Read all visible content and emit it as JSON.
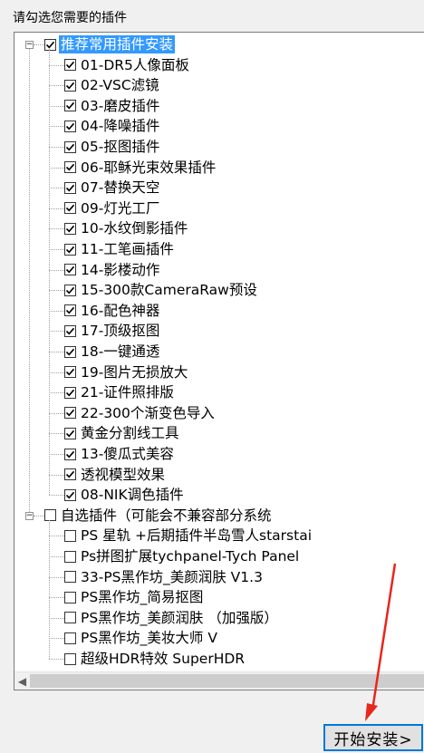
{
  "prompt": "请勾选您需要的插件",
  "groups": [
    {
      "label": "推荐常用插件安装",
      "expanded": true,
      "checked": true,
      "selected": true,
      "items": [
        {
          "label": "01-DR5人像面板",
          "checked": true
        },
        {
          "label": "02-VSC滤镜",
          "checked": true
        },
        {
          "label": "03-磨皮插件",
          "checked": true
        },
        {
          "label": "04-降噪插件",
          "checked": true
        },
        {
          "label": "05-抠图插件",
          "checked": true
        },
        {
          "label": "06-耶稣光束效果插件",
          "checked": true
        },
        {
          "label": "07-替换天空",
          "checked": true
        },
        {
          "label": "09-灯光工厂",
          "checked": true
        },
        {
          "label": "10-水纹倒影插件",
          "checked": true
        },
        {
          "label": "11-工笔画插件",
          "checked": true
        },
        {
          "label": "14-影楼动作",
          "checked": true
        },
        {
          "label": "15-300款CameraRaw预设",
          "checked": true
        },
        {
          "label": "16-配色神器",
          "checked": true
        },
        {
          "label": "17-顶级抠图",
          "checked": true
        },
        {
          "label": "18-一键通透",
          "checked": true
        },
        {
          "label": "19-图片无损放大",
          "checked": true
        },
        {
          "label": "21-证件照排版",
          "checked": true
        },
        {
          "label": "22-300个渐变色导入",
          "checked": true
        },
        {
          "label": "黄金分割线工具",
          "checked": true
        },
        {
          "label": "13-傻瓜式美容",
          "checked": true
        },
        {
          "label": "透视模型效果",
          "checked": true
        },
        {
          "label": "08-NIK调色插件",
          "checked": true
        }
      ]
    },
    {
      "label": "自选插件（可能会不兼容部分系统",
      "expanded": true,
      "checked": false,
      "selected": false,
      "items": [
        {
          "label": "PS 星轨 +后期插件半岛雪人starstai",
          "checked": false
        },
        {
          "label": "Ps拼图扩展tychpanel-Tych Panel",
          "checked": false
        },
        {
          "label": "33-PS黑作坊_美颜润肤 V1.3",
          "checked": false
        },
        {
          "label": "PS黑作坊_简易抠图",
          "checked": false
        },
        {
          "label": "PS黑作坊_美颜润肤 （加强版）",
          "checked": false
        },
        {
          "label": "PS黑作坊_美妆大师 V",
          "checked": false
        },
        {
          "label": "超级HDR特效 SuperHDR",
          "checked": false
        }
      ]
    }
  ],
  "install_button": "开始安装>",
  "colors": {
    "selection": "#3399ff",
    "button_border": "#0078d7",
    "annotation_arrow": "#e8261c"
  }
}
